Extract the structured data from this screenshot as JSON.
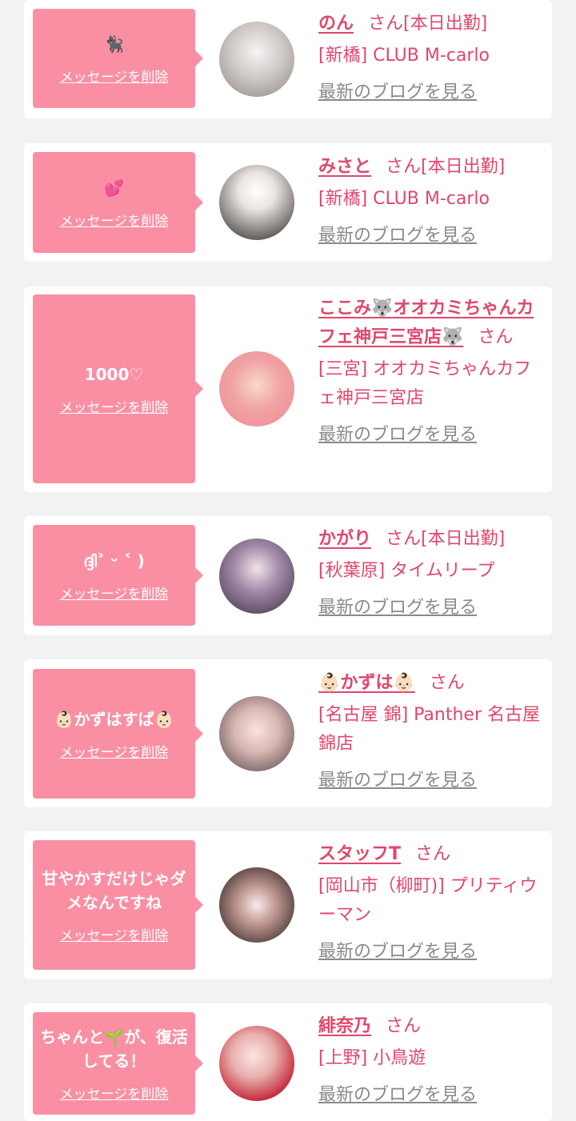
{
  "cards": [
    {
      "message": "🐈‍⬛",
      "delete_label": "メッセージを削除",
      "name": "のん",
      "suffix": "さん[本日出勤]",
      "shop": "[新橋] CLUB M-carlo",
      "blog_label": "最新のブログを見る"
    },
    {
      "message": "💕",
      "delete_label": "メッセージを削除",
      "name": "みさと",
      "suffix": "さん[本日出勤]",
      "shop": "[新橋] CLUB M-carlo",
      "blog_label": "最新のブログを見る"
    },
    {
      "message": "1000♡",
      "delete_label": "メッセージを削除",
      "name": "ここみ🐺オオカミちゃんカフェ神戸三宮店🐺",
      "suffix": "さん",
      "shop": "[三宮] オオカミちゃんカフェ神戸三宮店",
      "blog_label": "最新のブログを見る"
    },
    {
      "message": "ദ്ദി˃ ᵕ ˂ )",
      "delete_label": "メッセージを削除",
      "name": "かがり",
      "suffix": "さん[本日出勤]",
      "shop": "[秋葉原] タイムリープ",
      "blog_label": "最新のブログを見る"
    },
    {
      "message": "👶🏻かずはすぱ👶🏻",
      "delete_label": "メッセージを削除",
      "name": "👶🏻かずは👶🏻",
      "suffix": "さん",
      "shop": "[名古屋 錦] Panther 名古屋錦店",
      "blog_label": "最新のブログを見る"
    },
    {
      "message": "甘やかすだけじゃダメなんですね",
      "delete_label": "メッセージを削除",
      "name": "スタッフT",
      "suffix": "さん",
      "shop": "[岡山市（柳町)] プリティウーマン",
      "blog_label": "最新のブログを見る"
    },
    {
      "message": "ちゃんと🌱が、復活してる！",
      "delete_label": "メッセージを削除",
      "name": "緋奈乃",
      "suffix": "さん",
      "shop": "[上野] 小鳥遊",
      "blog_label": "最新のブログを見る"
    }
  ],
  "colors": {
    "accent": "#e0476b",
    "bubble": "#fa8fa3",
    "background": "#f2f2f2",
    "card": "#ffffff",
    "link_gray": "#8a8a8a"
  }
}
